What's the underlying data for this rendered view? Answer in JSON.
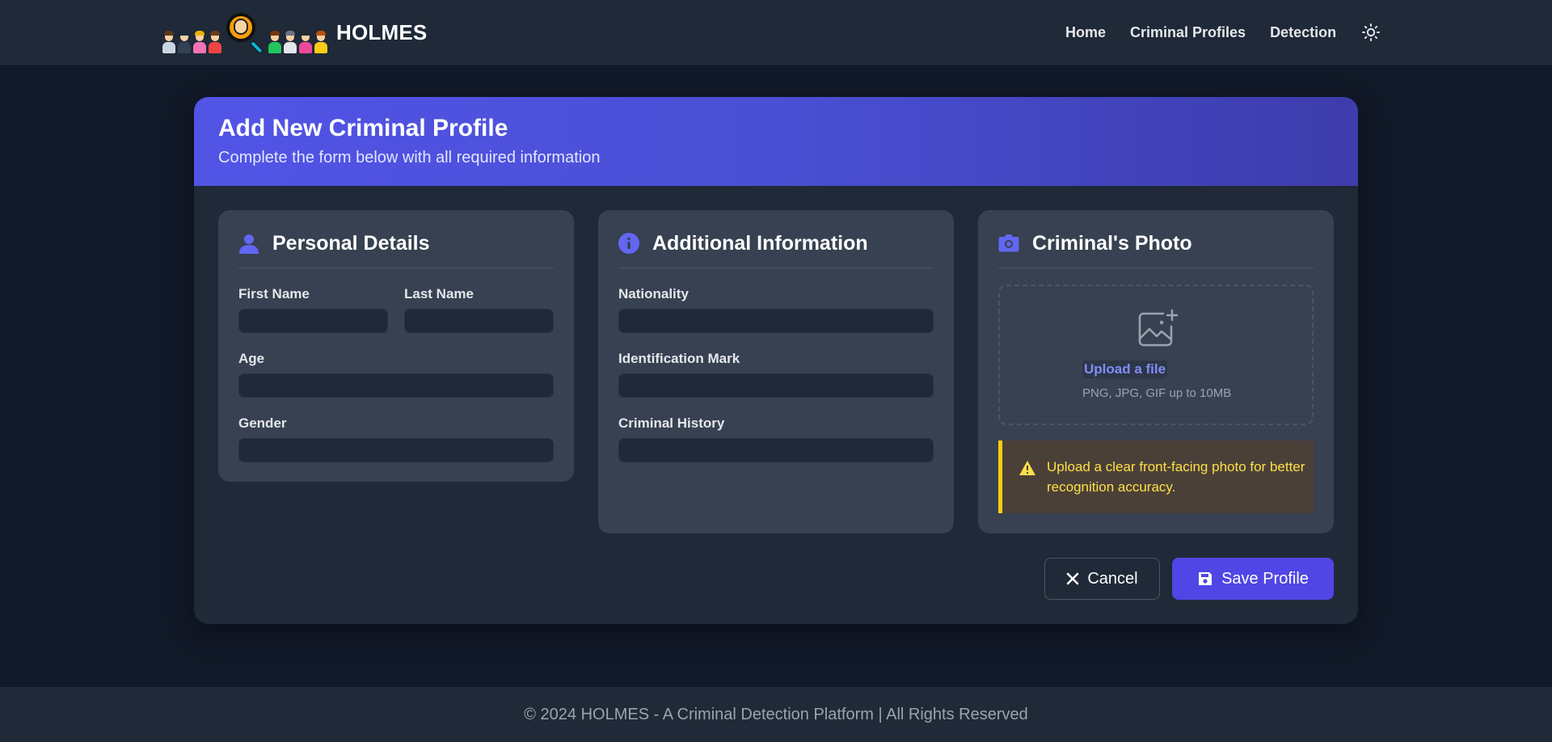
{
  "app": {
    "brand_name": "HOLMES"
  },
  "nav": {
    "links": [
      "Home",
      "Criminal Profiles",
      "Detection"
    ]
  },
  "form": {
    "title": "Add New Criminal Profile",
    "subtitle": "Complete the form below with all required information",
    "personal": {
      "title": "Personal Details",
      "first_name_label": "First Name",
      "first_name_value": "",
      "last_name_label": "Last Name",
      "last_name_value": "",
      "age_label": "Age",
      "age_value": "",
      "gender_label": "Gender",
      "gender_value": ""
    },
    "additional": {
      "title": "Additional Information",
      "nationality_label": "Nationality",
      "nationality_value": "",
      "id_mark_label": "Identification Mark",
      "id_mark_value": "",
      "history_label": "Criminal History",
      "history_value": ""
    },
    "photo": {
      "title": "Criminal's Photo",
      "upload_link": "Upload a file",
      "upload_hint": "PNG, JPG, GIF up to 10MB",
      "warning": "Upload a clear front-facing photo for better recognition accuracy."
    },
    "buttons": {
      "cancel": "Cancel",
      "save": "Save Profile"
    }
  },
  "footer": {
    "text": "© 2024 HOLMES - A Criminal Detection Platform | All Rights Reserved"
  },
  "colors": {
    "accent": "#4f46e5",
    "background": "#111827",
    "panel": "#374151",
    "warning": "#fde047"
  },
  "icons": [
    "logo-people-icon",
    "magnifier-icon",
    "sun-icon",
    "user-icon",
    "info-icon",
    "camera-icon",
    "image-add-icon",
    "warning-icon",
    "close-icon",
    "save-icon"
  ]
}
